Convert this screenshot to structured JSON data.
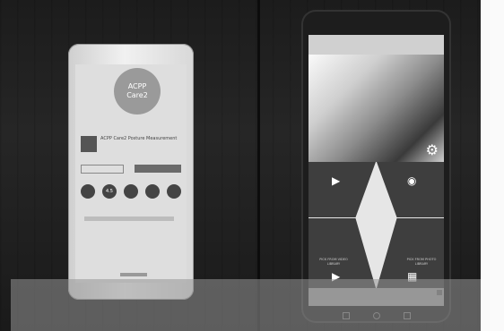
{
  "left_phone": {
    "logo_text": [
      "ACPP",
      "Care2"
    ],
    "app_title": "ACPP Care2 Posture Measurement",
    "developer": "",
    "stats": [
      "",
      "4.5",
      "",
      "",
      ""
    ],
    "brand": ""
  },
  "right_phone": {
    "app_title": "",
    "tiles": [
      {
        "label": "",
        "icon": "video-camera-icon"
      },
      {
        "label": "",
        "icon": "camera-icon"
      },
      {
        "label": "PICK FROM VIDEO LIBRARY",
        "icon": "play-icon"
      },
      {
        "label": "PICK FROM PHOTO LIBRARY",
        "icon": "image-icon"
      }
    ],
    "settings_icon": "gear-icon"
  },
  "colors": {
    "background": "#1c1c1c",
    "tile": "#3e3e3e"
  }
}
